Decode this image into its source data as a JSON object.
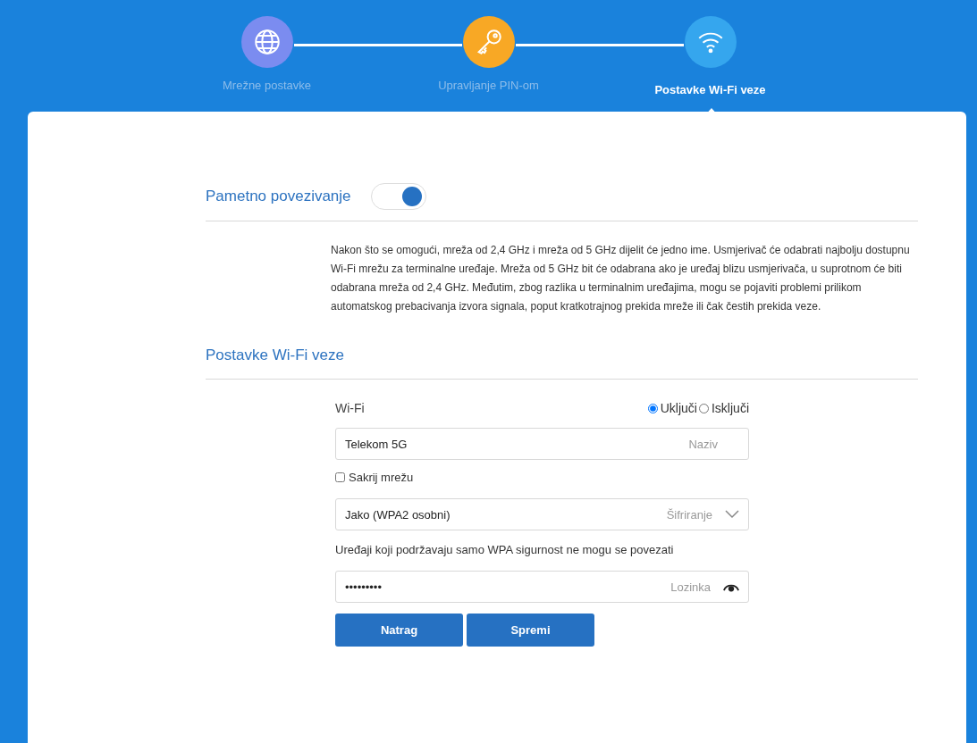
{
  "steps": [
    {
      "label": "Mrežne postavke",
      "kind": "globe",
      "color": "#7b8cf0",
      "selected": false
    },
    {
      "label": "Upravljanje PIN-om",
      "kind": "key",
      "color": "#f8a825",
      "selected": false
    },
    {
      "label": "Postavke Wi-Fi veze",
      "kind": "wifi",
      "color": "#35a6ee",
      "selected": true
    }
  ],
  "smart_connect": {
    "title": "Pametno povezivanje",
    "on": true,
    "description": "Nakon što se omogući, mreža od 2,4 GHz i mreža od 5 GHz dijelit će jedno ime. Usmjerivač će odabrati najbolju dostupnu Wi-Fi mrežu za terminalne uređaje. Mreža od 5 GHz bit će odabrana ako je uređaj blizu usmjerivača, u suprotnom će biti odabrana mreža od 2,4 GHz. Međutim, zbog razlika u terminalnim uređajima, mogu se pojaviti problemi prilikom automatskog prebacivanja izvora signala, poput kratkotrajnog prekida mreže ili čak čestih prekida veze."
  },
  "wifi_settings": {
    "title": "Postavke Wi-Fi veze",
    "wifi_label": "Wi-Fi",
    "radios": [
      {
        "label": "Uključi",
        "selected": true
      },
      {
        "label": "Isključi",
        "selected": false
      }
    ],
    "name_field": {
      "value": "Telekom 5G",
      "label": "Naziv"
    },
    "hide_network": {
      "label": "Sakrij mrežu",
      "checked": false
    },
    "encryption": {
      "value": "Jako (WPA2 osobni)",
      "label": "Šifriranje"
    },
    "note": "Uređaji koji podržavaju samo WPA sigurnost ne mogu se povezati",
    "password_field": {
      "value": "•••••••••",
      "label": "Lozinka"
    },
    "buttons": [
      "Natrag",
      "Spremi"
    ]
  }
}
